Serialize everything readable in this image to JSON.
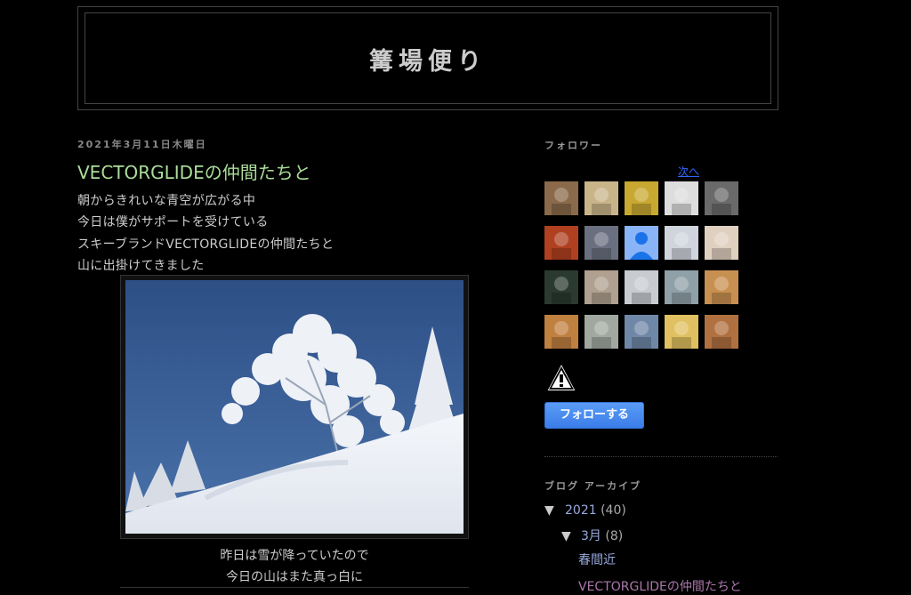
{
  "blog": {
    "title": "篝場便り"
  },
  "post": {
    "date": "2021年3月11日木曜日",
    "title": "VECTORGLIDEの仲間たちと",
    "lines": [
      "朝からきれいな青空が広がる中",
      "今日は僕がサポートを受けている",
      "スキーブランドVECTORGLIDEの仲間たちと",
      "山に出掛けてきました"
    ],
    "caption_lines": [
      "昨日は雪が降っていたので",
      "今日の山はまた真っ白に"
    ]
  },
  "sidebar": {
    "followers": {
      "heading": "フォロワー",
      "next_label": "次へ",
      "avatars": [
        {
          "icon": "person-photo-icon",
          "color": "#8a6a4a"
        },
        {
          "icon": "halo-photo-icon",
          "color": "#c9b48a"
        },
        {
          "icon": "person-yellow-photo-icon",
          "color": "#c8a830"
        },
        {
          "icon": "dog-photo-icon",
          "color": "#ddd"
        },
        {
          "icon": "flag-photo-icon",
          "color": "#6a6a6a"
        },
        {
          "icon": "red-photo-icon",
          "color": "#b04020"
        },
        {
          "icon": "tree-photo-icon",
          "color": "#6a7080"
        },
        {
          "icon": "default-avatar-icon",
          "color": "#8ab4f8"
        },
        {
          "icon": "snow-photo-icon",
          "color": "#d0d4dc"
        },
        {
          "icon": "face-photo-icon",
          "color": "#e0d0c0"
        },
        {
          "icon": "dark-photo-icon",
          "color": "#2a3a30"
        },
        {
          "icon": "group-photo-icon",
          "color": "#b0a090"
        },
        {
          "icon": "snow-photo-icon",
          "color": "#c8ccd0"
        },
        {
          "icon": "tree-snow-photo-icon",
          "color": "#90a0a8"
        },
        {
          "icon": "hat-photo-icon",
          "color": "#c89050"
        },
        {
          "icon": "face-photo-icon",
          "color": "#c08040"
        },
        {
          "icon": "snow-person-photo-icon",
          "color": "#a0a8a0"
        },
        {
          "icon": "landscape-photo-icon",
          "color": "#7088a8"
        },
        {
          "icon": "cartoon-photo-icon",
          "color": "#e0c060"
        },
        {
          "icon": "person-photo-icon",
          "color": "#b07040"
        }
      ],
      "follow_button_label": "フォローする"
    },
    "archive": {
      "heading": "ブログ アーカイブ",
      "year": {
        "toggle": "▼",
        "label": "2021",
        "count": "(40)"
      },
      "month": {
        "toggle": "▼",
        "label": "3月",
        "count": "(8)"
      },
      "posts": [
        "春間近",
        "VECTORGLIDEの仲間たちと"
      ]
    }
  }
}
